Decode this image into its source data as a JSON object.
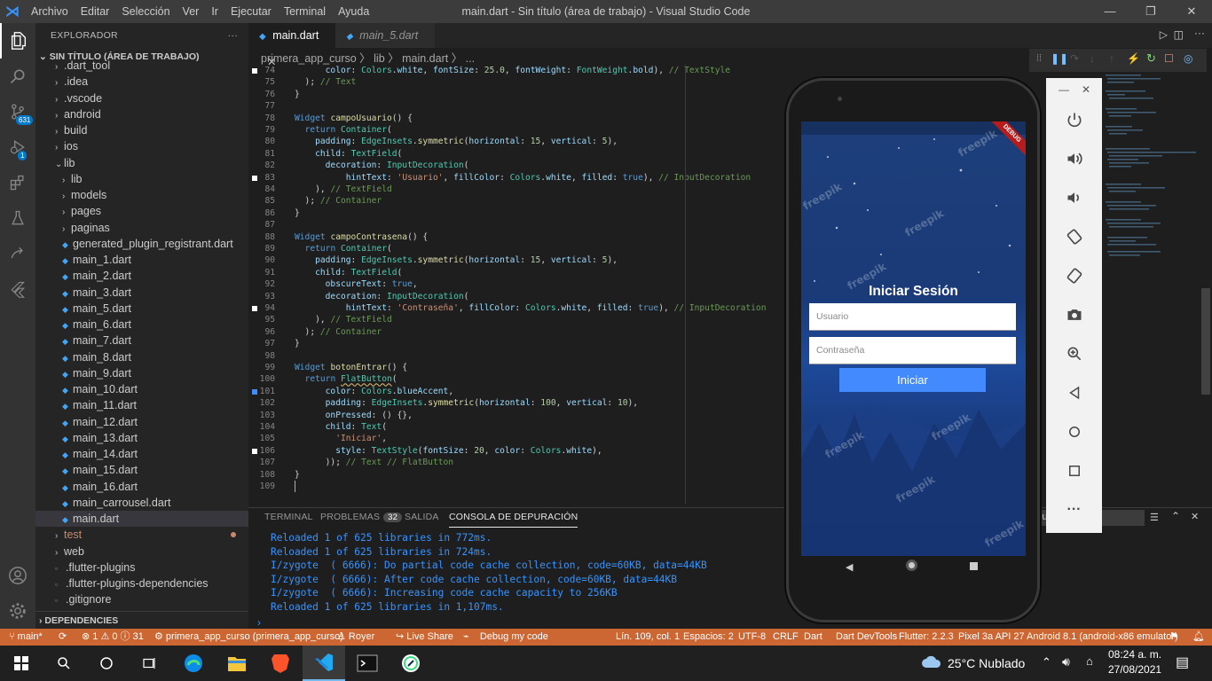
{
  "titlebar": {
    "menu": [
      "Archivo",
      "Editar",
      "Selección",
      "Ver",
      "Ir",
      "Ejecutar",
      "Terminal",
      "Ayuda"
    ],
    "title": "main.dart - Sin título (área de trabajo) - Visual Studio Code"
  },
  "activitybar": {
    "scm_badge": "631",
    "debug_badge": "1"
  },
  "explorer": {
    "header": "EXPLORADOR",
    "workspace": "SIN TÍTULO (ÁREA DE TRABAJO)",
    "items": [
      {
        "label": ".dart_tool",
        "type": "folder",
        "depth": 1
      },
      {
        "label": ".idea",
        "type": "folder",
        "depth": 1
      },
      {
        "label": ".vscode",
        "type": "folder",
        "depth": 1
      },
      {
        "label": "android",
        "type": "folder",
        "depth": 1
      },
      {
        "label": "build",
        "type": "folder",
        "depth": 1
      },
      {
        "label": "ios",
        "type": "folder",
        "depth": 1
      },
      {
        "label": "lib",
        "type": "folder-open",
        "depth": 1
      },
      {
        "label": "lib",
        "type": "folder",
        "depth": 2
      },
      {
        "label": "models",
        "type": "folder",
        "depth": 2
      },
      {
        "label": "pages",
        "type": "folder",
        "depth": 2
      },
      {
        "label": "paginas",
        "type": "folder",
        "depth": 2
      },
      {
        "label": "generated_plugin_registrant.dart",
        "type": "dart",
        "depth": 2
      },
      {
        "label": "main_1.dart",
        "type": "dart",
        "depth": 2
      },
      {
        "label": "main_2.dart",
        "type": "dart",
        "depth": 2
      },
      {
        "label": "main_3.dart",
        "type": "dart",
        "depth": 2
      },
      {
        "label": "main_5.dart",
        "type": "dart",
        "depth": 2
      },
      {
        "label": "main_6.dart",
        "type": "dart",
        "depth": 2
      },
      {
        "label": "main_7.dart",
        "type": "dart",
        "depth": 2
      },
      {
        "label": "main_8.dart",
        "type": "dart",
        "depth": 2
      },
      {
        "label": "main_9.dart",
        "type": "dart",
        "depth": 2
      },
      {
        "label": "main_10.dart",
        "type": "dart",
        "depth": 2
      },
      {
        "label": "main_11.dart",
        "type": "dart",
        "depth": 2
      },
      {
        "label": "main_12.dart",
        "type": "dart",
        "depth": 2
      },
      {
        "label": "main_13.dart",
        "type": "dart",
        "depth": 2
      },
      {
        "label": "main_14.dart",
        "type": "dart",
        "depth": 2
      },
      {
        "label": "main_15.dart",
        "type": "dart",
        "depth": 2
      },
      {
        "label": "main_16.dart",
        "type": "dart",
        "depth": 2
      },
      {
        "label": "main_carrousel.dart",
        "type": "dart",
        "depth": 2
      },
      {
        "label": "main.dart",
        "type": "dart",
        "depth": 2,
        "selected": true
      },
      {
        "label": "test",
        "type": "folder",
        "depth": 1,
        "modified": true
      },
      {
        "label": "web",
        "type": "folder",
        "depth": 1
      },
      {
        "label": ".flutter-plugins",
        "type": "file",
        "depth": 1
      },
      {
        "label": ".flutter-plugins-dependencies",
        "type": "file",
        "depth": 1
      },
      {
        "label": ".gitignore",
        "type": "file",
        "depth": 1
      }
    ],
    "dependencies": "DEPENDENCIES"
  },
  "tabs": [
    {
      "label": "main.dart",
      "active": true
    },
    {
      "label": "main_5.dart",
      "active": false
    }
  ],
  "breadcrumb": "primera_app_curso  〉 lib  〉 main.dart  〉 ...",
  "code_lines": [
    {
      "n": "74",
      "text": "      color: Colors.white, fontSize: 25.0, fontWeight: FontWeight.bold), // TextStyle",
      "mark": "white"
    },
    {
      "n": "75",
      "text": "  ); // Text"
    },
    {
      "n": "76",
      "text": "}"
    },
    {
      "n": "77",
      "text": ""
    },
    {
      "n": "78",
      "text": "Widget campoUsuario() {"
    },
    {
      "n": "79",
      "text": "  return Container("
    },
    {
      "n": "80",
      "text": "    padding: EdgeInsets.symmetric(horizontal: 15, vertical: 5),"
    },
    {
      "n": "81",
      "text": "    child: TextField("
    },
    {
      "n": "82",
      "text": "      decoration: InputDecoration("
    },
    {
      "n": "83",
      "text": "          hintText: 'Usuario', fillColor: Colors.white, filled: true), // InputDecoration",
      "mark": "white"
    },
    {
      "n": "84",
      "text": "    ), // TextField"
    },
    {
      "n": "85",
      "text": "  ); // Container"
    },
    {
      "n": "86",
      "text": "}"
    },
    {
      "n": "87",
      "text": ""
    },
    {
      "n": "88",
      "text": "Widget campoContrasena() {"
    },
    {
      "n": "89",
      "text": "  return Container("
    },
    {
      "n": "90",
      "text": "    padding: EdgeInsets.symmetric(horizontal: 15, vertical: 5),"
    },
    {
      "n": "91",
      "text": "    child: TextField("
    },
    {
      "n": "92",
      "text": "      obscureText: true,"
    },
    {
      "n": "93",
      "text": "      decoration: InputDecoration("
    },
    {
      "n": "94",
      "text": "          hintText: 'Contraseña', fillColor: Colors.white, filled: true), // InputDecoration",
      "mark": "white"
    },
    {
      "n": "95",
      "text": "    ), // TextField"
    },
    {
      "n": "96",
      "text": "  ); // Container"
    },
    {
      "n": "97",
      "text": "}"
    },
    {
      "n": "98",
      "text": ""
    },
    {
      "n": "99",
      "text": "Widget botonEntrar() {"
    },
    {
      "n": "100",
      "text": "  return FlatButton("
    },
    {
      "n": "101",
      "text": "      color: Colors.blueAccent,",
      "mark": "blue"
    },
    {
      "n": "102",
      "text": "      padding: EdgeInsets.symmetric(horizontal: 100, vertical: 10),"
    },
    {
      "n": "103",
      "text": "      onPressed: () {},"
    },
    {
      "n": "104",
      "text": "      child: Text("
    },
    {
      "n": "105",
      "text": "        'Iniciar',"
    },
    {
      "n": "106",
      "text": "        style: TextStyle(fontSize: 20, color: Colors.white),",
      "mark": "white"
    },
    {
      "n": "107",
      "text": "      )); // Text // FlatButton"
    },
    {
      "n": "108",
      "text": "}"
    },
    {
      "n": "109",
      "text": ""
    }
  ],
  "panel": {
    "tabs": [
      "TERMINAL",
      "PROBLEMAS",
      "SALIDA",
      "CONSOLA DE DEPURACIÓN"
    ],
    "problems_count": "32",
    "output": [
      "Reloaded 1 of 625 libraries in 772ms.",
      "Reloaded 1 of 625 libraries in 724ms.",
      "I/zygote  ( 6666): Do partial code cache collection, code=60KB, data=44KB",
      "I/zygote  ( 6666): After code cache collection, code=60KB, data=44KB",
      "I/zygote  ( 6666): Increasing code cache capacity to 256KB",
      "Reloaded 1 of 625 libraries in 1,107ms."
    ],
    "filter_text": "lu"
  },
  "statusbar": {
    "branch": "main*",
    "problems": "⊗ 1 ⚠ 0 ⓘ 31",
    "project": "primera_app_curso (primera_app_curso)",
    "user": "Royer",
    "liveshare": "Live Share",
    "debug_mode": "Debug my code",
    "position": "Lín. 109, col. 1",
    "spaces": "Espacios: 2",
    "encoding": "UTF-8",
    "eol": "CRLF",
    "language": "Dart",
    "devtools": "Dart DevTools",
    "flutter": "Flutter: 2.2.3",
    "device": "Pixel 3a API 27 Android 8.1 (android-x86 emulator)"
  },
  "app": {
    "title": "Iniciar Sesión",
    "user_hint": "Usuario",
    "pass_hint": "Contraseña",
    "button": "Iniciar",
    "debug_banner": "DEBUG",
    "watermark": "freepik"
  },
  "taskbar": {
    "weather": "25°C  Nublado",
    "time": "08:24 a. m.",
    "date": "27/08/2021"
  },
  "colors": {
    "statusbar": "#cc6633",
    "app_button": "#448aff",
    "accent": "#007acc"
  }
}
